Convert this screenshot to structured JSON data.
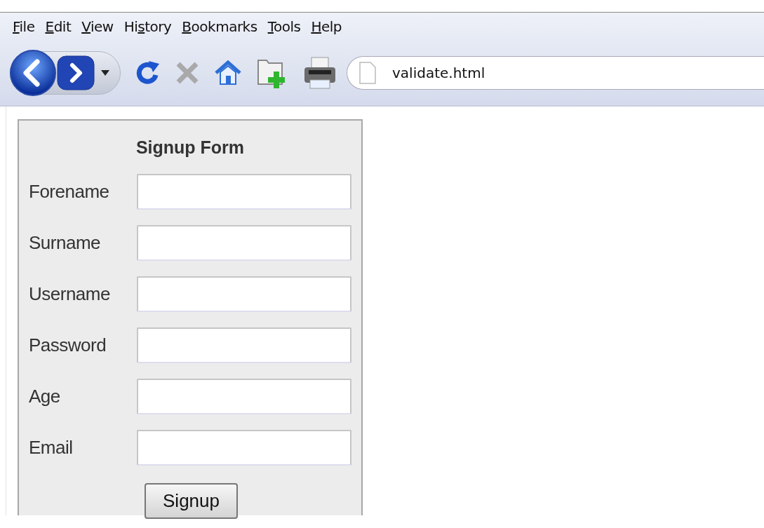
{
  "menu": [
    {
      "parts": [
        {
          "text": "F",
          "underlined": true
        },
        {
          "text": "ile",
          "underlined": false
        }
      ]
    },
    {
      "parts": [
        {
          "text": "E",
          "underlined": true
        },
        {
          "text": "dit",
          "underlined": false
        }
      ]
    },
    {
      "parts": [
        {
          "text": "V",
          "underlined": true
        },
        {
          "text": "iew",
          "underlined": false
        }
      ]
    },
    {
      "parts": [
        {
          "text": "Hi",
          "underlined": false
        },
        {
          "text": "s",
          "underlined": true
        },
        {
          "text": "tory",
          "underlined": false
        }
      ]
    },
    {
      "parts": [
        {
          "text": "B",
          "underlined": true
        },
        {
          "text": "ookmarks",
          "underlined": false
        }
      ]
    },
    {
      "parts": [
        {
          "text": "T",
          "underlined": true
        },
        {
          "text": "ools",
          "underlined": false
        }
      ]
    },
    {
      "parts": [
        {
          "text": "H",
          "underlined": true
        },
        {
          "text": "elp",
          "underlined": false
        }
      ]
    }
  ],
  "address_bar": {
    "value": "validate.html"
  },
  "form": {
    "title": "Signup Form",
    "fields": [
      {
        "label": "Forename"
      },
      {
        "label": "Surname"
      },
      {
        "label": "Username"
      },
      {
        "label": "Password"
      },
      {
        "label": "Age"
      },
      {
        "label": "Email"
      }
    ],
    "submit": "Signup"
  }
}
